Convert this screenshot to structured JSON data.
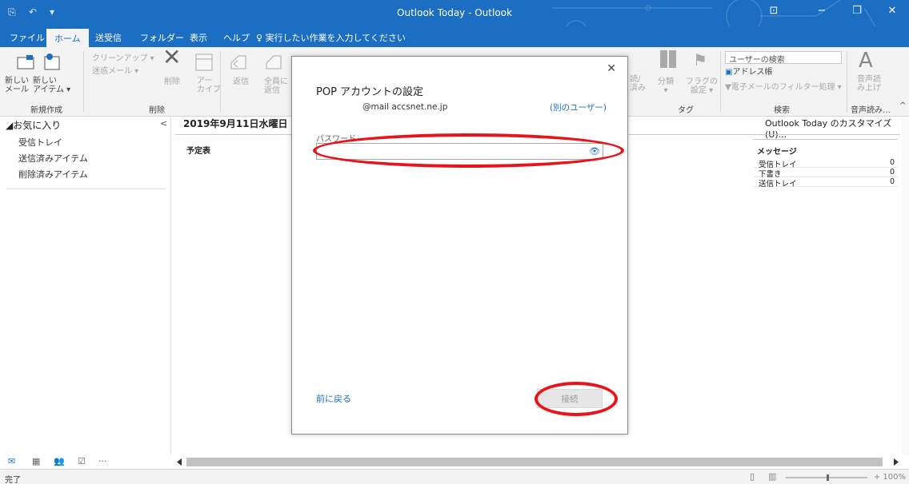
{
  "window": {
    "title": "Outlook Today  -  Outlook",
    "quick_access": [
      "⎘",
      "↶",
      "▾"
    ],
    "controls": [
      "⊡",
      "−",
      "❐",
      "✕"
    ]
  },
  "tabs": [
    "ファイル",
    "ホーム",
    "送受信",
    "フォルダー",
    "表示",
    "ヘルプ"
  ],
  "active_tab": "ホーム",
  "tell_me": "実行したい作業を入力してください",
  "ribbon": {
    "new_mail": "新しい\nメール",
    "new_items": "新しい\nアイテム ▾",
    "group_new": "新規作成",
    "cleanup": "クリーンアップ ▾",
    "junk": "迷惑メール ▾",
    "delete": "削除",
    "archive": "アー\nカイブ",
    "group_delete": "削除",
    "reply": "返信",
    "reply_all": "全員に\n返信",
    "unread_read": "読/\n済み",
    "categorize": "分類\n▾",
    "follow_up": "フラグの\n設定 ▾",
    "group_tags": "タグ",
    "user_search": "ユーザーの検索",
    "address_book": "アドレス帳",
    "filter_email": "電子メールのフィルター処理 ▾",
    "group_search": "検索",
    "read_aloud": "音声読\nみ上げ",
    "group_speech": "音声読み…"
  },
  "leftnav": {
    "favorites": "◢お気に入り",
    "collapse": "<",
    "items": [
      "受信トレイ",
      "送信済みアイテム",
      "削除済みアイテム"
    ]
  },
  "main": {
    "date": "2019年9月11日水曜日",
    "customize": "Outlook Today のカスタマイズ(U)...",
    "schedule": "予定表",
    "messages_title": "メッセージ",
    "messages": [
      {
        "name": "受信トレイ",
        "count": "0"
      },
      {
        "name": "下書き",
        "count": "0"
      },
      {
        "name": "送信トレイ",
        "count": "0"
      }
    ]
  },
  "bottomnav": [
    "✉",
    "▦",
    "👥",
    "☑",
    "···"
  ],
  "status": {
    "text": "完了",
    "zoom": "+ 100%"
  },
  "dialog": {
    "close": "✕",
    "title": "POP アカウントの設定",
    "email": "@mail  accsnet.ne.jp",
    "other_user": "(別のユーザー)",
    "password_label": "パスワード",
    "password_value": "",
    "eye_icon": "👁",
    "back": "前に戻る",
    "connect": "接続"
  },
  "colors": {
    "brand": "#1b6ec2",
    "annotation": "#e8141a"
  }
}
